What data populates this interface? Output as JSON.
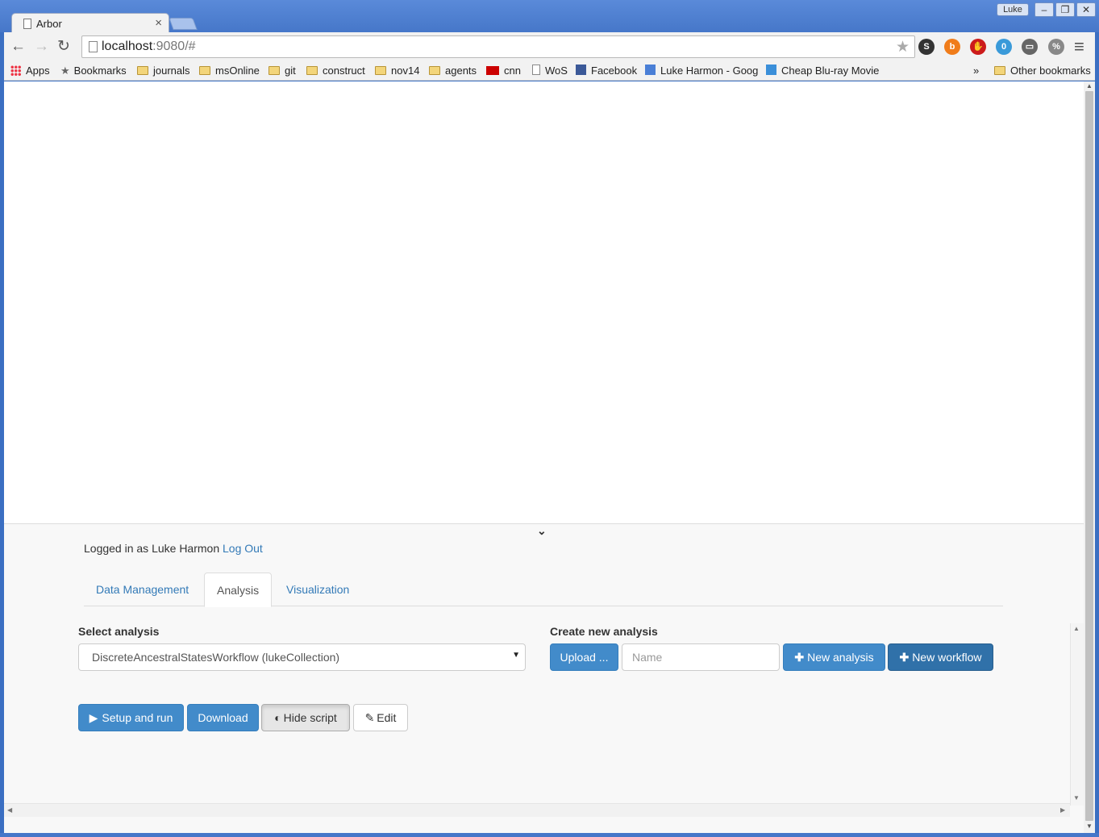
{
  "window": {
    "tab_title": "Arbor",
    "tab_close": "×",
    "user": "Luke",
    "minimize": "–",
    "maximize": "❐",
    "close": "✕"
  },
  "toolbar": {
    "back": "←",
    "forward": "→",
    "reload": "↻",
    "url_host": "localhost",
    "url_rest": ":9080/#",
    "star": "★",
    "menu": "≡"
  },
  "extensions": [
    {
      "name": "s-extension-icon",
      "glyph": "S",
      "color": "#333333"
    },
    {
      "name": "b-extension-icon",
      "glyph": "b",
      "color": "#f07c1a"
    },
    {
      "name": "hand-extension-icon",
      "glyph": "✋",
      "color": "#cc1b1b"
    },
    {
      "name": "ghostery-icon",
      "glyph": "0",
      "color": "#3a9ad9"
    },
    {
      "name": "cast-icon",
      "glyph": "▭",
      "color": "#666666"
    },
    {
      "name": "percent-extension-icon",
      "glyph": "%",
      "color": "#888888"
    }
  ],
  "bookmarks": {
    "items": [
      "Apps",
      "Bookmarks",
      "journals",
      "msOnline",
      "git",
      "construct",
      "nov14",
      "agents",
      "cnn",
      "WoS",
      "Facebook",
      "Luke Harmon - Googl",
      "Cheap Blu-ray Movie"
    ],
    "overflow": "»",
    "other": "Other bookmarks"
  },
  "panel": {
    "collapse_glyph": "⌄",
    "logged_in_text": "Logged in as Luke Harmon",
    "logout_label": "Log Out",
    "tabs": [
      "Data Management",
      "Analysis",
      "Visualization"
    ],
    "active_tab": "Analysis",
    "select_analysis_label": "Select analysis",
    "selected_analysis": "DiscreteAncestralStatesWorkflow (lukeCollection)",
    "select_caret": "▼",
    "create_label": "Create new analysis",
    "upload_label": "Upload ...",
    "name_placeholder": "Name",
    "new_analysis_label": "New analysis",
    "new_workflow_label": "New workflow",
    "setup_run_label": "Setup and run",
    "download_label": "Download",
    "hide_script_label": "Hide script",
    "edit_label": "Edit"
  }
}
